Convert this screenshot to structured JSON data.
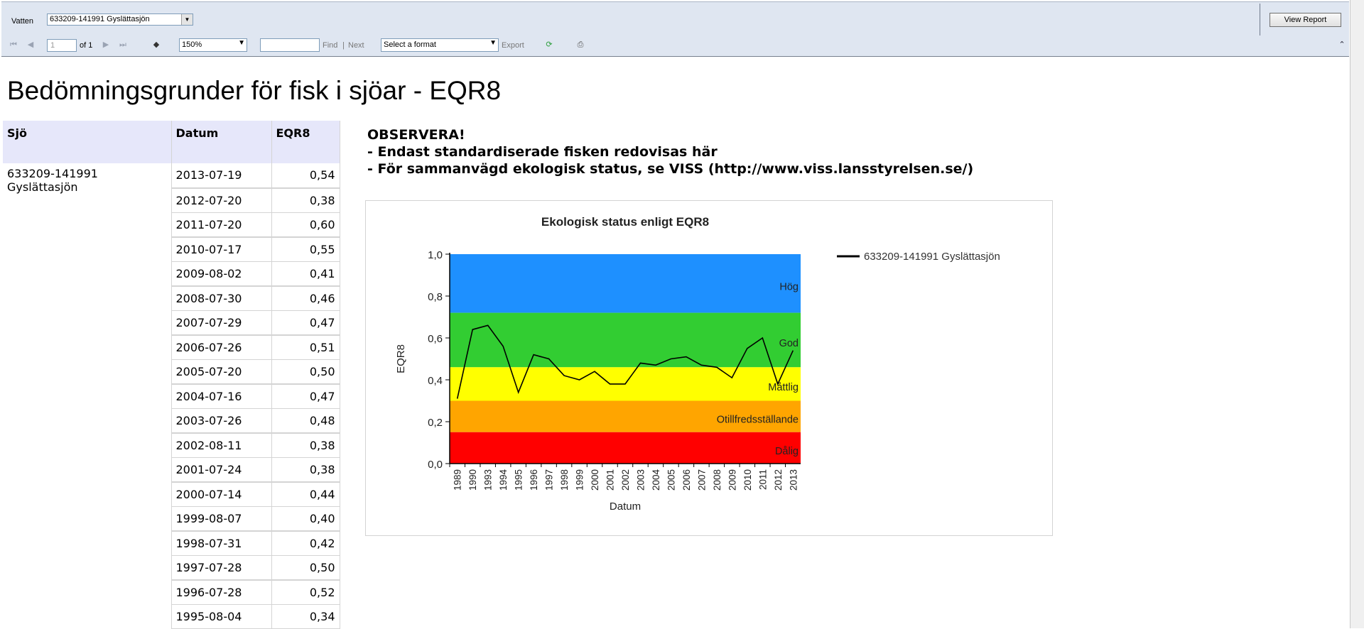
{
  "params": {
    "vatten_label": "Vatten",
    "vatten_value": "633209-141991 Gyslättasjön",
    "view_report": "View Report"
  },
  "toolbar": {
    "page_current": "1",
    "page_of": "of 1",
    "zoom": "150%",
    "find_label": "Find",
    "separator": "|",
    "next_label": "Next",
    "format_placeholder": "Select a format",
    "export_label": "Export"
  },
  "report": {
    "title": "Bedömningsgrunder för fisk i sjöar - EQR8",
    "columns": [
      "Sjö",
      "Datum",
      "EQR8"
    ],
    "lake_line1": "633209-141991",
    "lake_line2": "Gyslättasjön",
    "rows": [
      {
        "datum": "2013-07-19",
        "eqr8": "0,54"
      },
      {
        "datum": "2012-07-20",
        "eqr8": "0,38"
      },
      {
        "datum": "2011-07-20",
        "eqr8": "0,60"
      },
      {
        "datum": "2010-07-17",
        "eqr8": "0,55"
      },
      {
        "datum": "2009-08-02",
        "eqr8": "0,41"
      },
      {
        "datum": "2008-07-30",
        "eqr8": "0,46"
      },
      {
        "datum": "2007-07-29",
        "eqr8": "0,47"
      },
      {
        "datum": "2006-07-26",
        "eqr8": "0,51"
      },
      {
        "datum": "2005-07-20",
        "eqr8": "0,50"
      },
      {
        "datum": "2004-07-16",
        "eqr8": "0,47"
      },
      {
        "datum": "2003-07-26",
        "eqr8": "0,48"
      },
      {
        "datum": "2002-08-11",
        "eqr8": "0,38"
      },
      {
        "datum": "2001-07-24",
        "eqr8": "0,38"
      },
      {
        "datum": "2000-07-14",
        "eqr8": "0,44"
      },
      {
        "datum": "1999-08-07",
        "eqr8": "0,40"
      },
      {
        "datum": "1998-07-31",
        "eqr8": "0,42"
      },
      {
        "datum": "1997-07-28",
        "eqr8": "0,50"
      },
      {
        "datum": "1996-07-28",
        "eqr8": "0,52"
      },
      {
        "datum": "1995-08-04",
        "eqr8": "0,34"
      }
    ],
    "observera": {
      "line1": "OBSERVERA!",
      "line2": "- Endast standardiserade fisken redovisas här",
      "line3": "- För sammanvägd ekologisk status, se VISS (http://www.viss.lansstyrelsen.se/)"
    }
  },
  "chart_data": {
    "type": "line",
    "title": "Ekologisk status enligt EQR8",
    "xlabel": "Datum",
    "ylabel": "EQR8",
    "ylim": [
      0,
      1
    ],
    "y_ticks": [
      "0,0",
      "0,2",
      "0,4",
      "0,6",
      "0,8",
      "1,0"
    ],
    "categories": [
      "1989",
      "1990",
      "1993",
      "1994",
      "1995",
      "1996",
      "1997",
      "1998",
      "1999",
      "2000",
      "2001",
      "2002",
      "2003",
      "2004",
      "2005",
      "2006",
      "2007",
      "2008",
      "2009",
      "2010",
      "2011",
      "2012",
      "2013"
    ],
    "series": [
      {
        "name": "633209-141991 Gyslättasjön",
        "color": "#000000",
        "values": [
          0.31,
          0.64,
          0.66,
          0.56,
          0.34,
          0.52,
          0.5,
          0.42,
          0.4,
          0.44,
          0.38,
          0.38,
          0.48,
          0.47,
          0.5,
          0.51,
          0.47,
          0.46,
          0.41,
          0.55,
          0.6,
          0.38,
          0.54
        ]
      }
    ],
    "bands": [
      {
        "label": "Hög",
        "from": 0.72,
        "to": 1.0,
        "color": "#1e90ff"
      },
      {
        "label": "God",
        "from": 0.46,
        "to": 0.72,
        "color": "#32cd32"
      },
      {
        "label": "Måttlig",
        "from": 0.3,
        "to": 0.46,
        "color": "#ffff00"
      },
      {
        "label": "Otillfredsställande",
        "from": 0.15,
        "to": 0.3,
        "color": "#ffa500"
      },
      {
        "label": "Dålig",
        "from": 0.0,
        "to": 0.15,
        "color": "#ff0000"
      }
    ],
    "legend_position": "right"
  }
}
